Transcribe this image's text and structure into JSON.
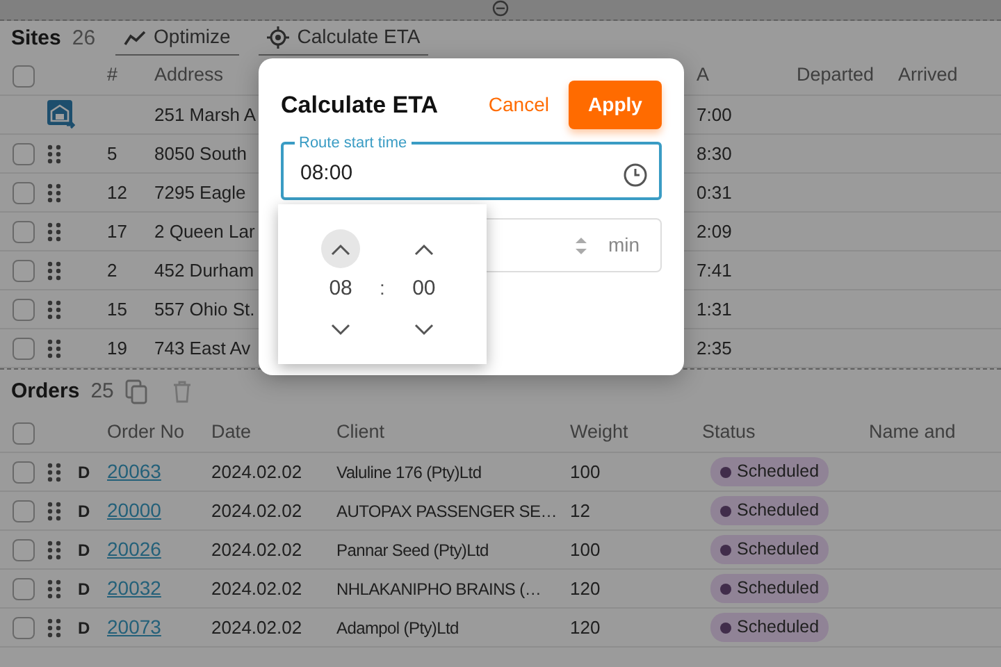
{
  "sites": {
    "title": "Sites",
    "count": "26",
    "actions": [
      {
        "label": "Optimize",
        "kind": "chart"
      },
      {
        "label": "Calculate ETA",
        "kind": "target"
      }
    ],
    "header_checked": false,
    "columns": [
      "#",
      "Address",
      "A",
      "Departed",
      "Arrived"
    ],
    "rows": [
      {
        "kind": "depot",
        "address": "251 Marsh A",
        "eta": "7:00"
      },
      {
        "kind": "site",
        "checked": false,
        "number": "5",
        "address": "8050 South",
        "eta": "8:30"
      },
      {
        "kind": "site",
        "checked": false,
        "number": "12",
        "address": "7295 Eagle",
        "eta": "0:31"
      },
      {
        "kind": "site",
        "checked": false,
        "number": "17",
        "address": "2 Queen Lar",
        "eta": "2:09"
      },
      {
        "kind": "site",
        "checked": false,
        "number": "2",
        "address": "452 Durham",
        "eta": "7:41"
      },
      {
        "kind": "site",
        "checked": false,
        "number": "15",
        "address": "557 Ohio St.",
        "eta": "1:31"
      },
      {
        "kind": "site",
        "checked": false,
        "number": "19",
        "address": "743 East Av",
        "eta": "2:35"
      }
    ]
  },
  "orders": {
    "title": "Orders",
    "count": "25",
    "header_checked": false,
    "columns": [
      "Order No",
      "Date",
      "Client",
      "Weight",
      "Status",
      "Name and"
    ],
    "rows": [
      {
        "checked": false,
        "type": "D",
        "order_no": "20063",
        "date": "2024.02.02",
        "client": "Valuline 176 (Pty)Ltd",
        "weight": "100",
        "status": "Scheduled"
      },
      {
        "checked": false,
        "type": "D",
        "order_no": "20000",
        "date": "2024.02.02",
        "client": "AUTOPAX PASSENGER SE…",
        "weight": "12",
        "status": "Scheduled"
      },
      {
        "checked": false,
        "type": "D",
        "order_no": "20026",
        "date": "2024.02.02",
        "client": "Pannar Seed (Pty)Ltd",
        "weight": "100",
        "status": "Scheduled"
      },
      {
        "checked": false,
        "type": "D",
        "order_no": "20032",
        "date": "2024.02.02",
        "client": "NHLAKANIPHO BRAINS (…",
        "weight": "120",
        "status": "Scheduled"
      },
      {
        "checked": false,
        "type": "D",
        "order_no": "20073",
        "date": "2024.02.02",
        "client": "Adampol (Pty)Ltd",
        "weight": "120",
        "status": "Scheduled"
      }
    ]
  },
  "dialog": {
    "title": "Calculate ETA",
    "cancel": "Cancel",
    "apply": "Apply",
    "start_time": {
      "label": "Route start time",
      "value": "08:00"
    },
    "duration": {
      "unit": "min"
    },
    "picker": {
      "hours": "08",
      "separator": ":",
      "minutes": "00",
      "hours_up_highlighted": true
    }
  }
}
